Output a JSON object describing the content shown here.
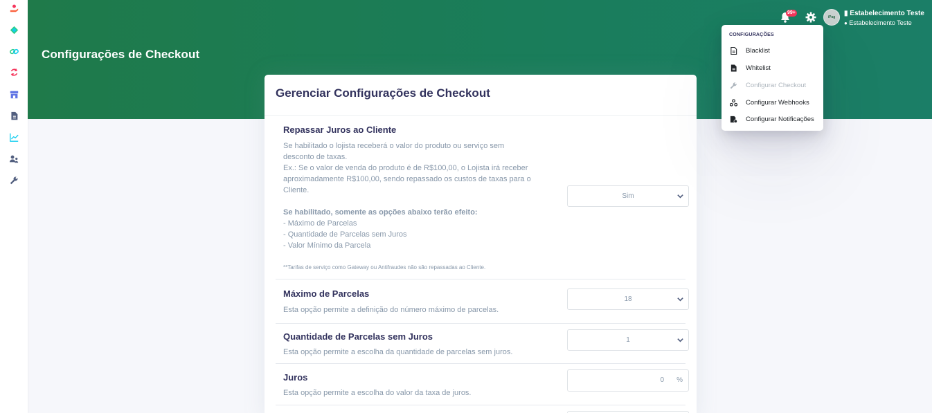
{
  "sidebar": {
    "icons": [
      "hand-coin-icon",
      "diamond-icon",
      "link-icon",
      "refresh-icon",
      "store-icon",
      "document-icon",
      "chart-line-icon",
      "users-icon",
      "wrench-icon"
    ],
    "colors": [
      "#f5365c",
      "#2dce89",
      "#11cdef",
      "#f5365c",
      "#5e72e4",
      "#525f7f",
      "#11cdef",
      "#525f7f",
      "#525f7f"
    ]
  },
  "header": {
    "page_title": "Configurações de Checkout",
    "notification_count": "99+",
    "avatar_text": "iPag",
    "user_name": "Estabelecimento Teste",
    "user_sub": "Estabelecimento Teste"
  },
  "card": {
    "title": "Gerenciar Configurações de Checkout",
    "rows": [
      {
        "title": "Repassar Juros ao Cliente",
        "desc_lines": [
          "Se habilitado o lojista receberá o valor do produto ou serviço sem",
          "desconto de taxas.",
          "Ex.: Se o valor de venda do produto é de R$100,00, o Lojista irá receber",
          "aproximadamente R$100,00, sendo repassado os custos de taxas para o",
          "Cliente."
        ],
        "strong_line": "Se habilitado, somente as opções abaixo terão efeito:",
        "bullets": [
          "- Máximo de Parcelas",
          "- Quantidade de Parcelas sem Juros",
          "- Valor Mínimo da Parcela"
        ],
        "footnote": "**Tarifas de serviço como Gateway ou Antifraudes não são repassadas ao Cliente.",
        "value": "Sim"
      },
      {
        "title": "Máximo de Parcelas",
        "desc": "Esta opção permite a definição do número máximo de parcelas.",
        "value": "18"
      },
      {
        "title": "Quantidade de Parcelas sem Juros",
        "desc": "Esta opção permite a escolha da quantidade de parcelas sem juros.",
        "value": "1"
      },
      {
        "title": "Juros",
        "desc": "Esta opção permite a escolha do valor da taxa de juros.",
        "value": "0",
        "unit": "%"
      }
    ]
  },
  "dropdown": {
    "header": "CONFIGURAÇÕES",
    "items": [
      {
        "label": "Blacklist",
        "icon": "file-list-icon",
        "disabled": false
      },
      {
        "label": "Whitelist",
        "icon": "file-solid-icon",
        "disabled": false
      },
      {
        "label": "Configurar Checkout",
        "icon": "wrench-icon",
        "disabled": true
      },
      {
        "label": "Configurar Webhooks",
        "icon": "webhook-icon",
        "disabled": false
      },
      {
        "label": "Configurar Notificações",
        "icon": "notification-config-icon",
        "disabled": false
      }
    ]
  },
  "colors": {
    "header_green": "#1f7a4a",
    "badge": "#f5365c",
    "text_dark": "#32325d",
    "text_muted": "#8898aa"
  }
}
